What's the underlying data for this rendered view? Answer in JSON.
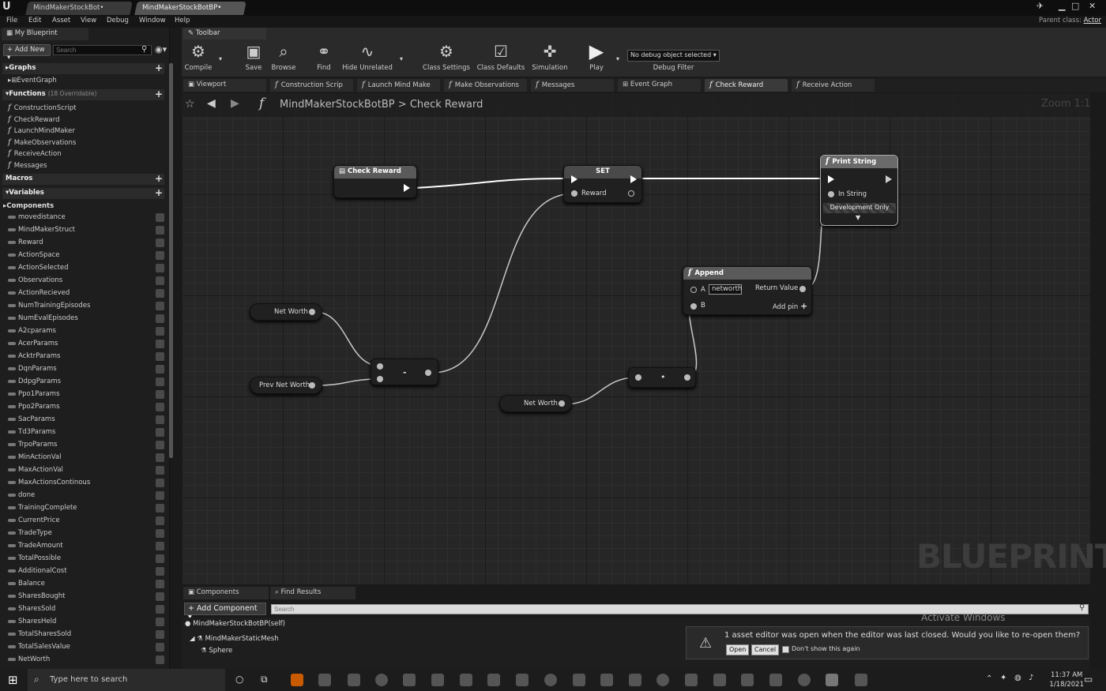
{
  "window": {
    "tabs": [
      "MindMakerStockBot•",
      "MindMakerStockBotBP•"
    ],
    "parent_class_label": "Parent class:",
    "parent_class_value": "Actor"
  },
  "menu": [
    "File",
    "Edit",
    "Asset",
    "View",
    "Debug",
    "Window",
    "Help"
  ],
  "my_blueprint": {
    "tab_label": "My Blueprint",
    "add_new_label": "+ Add New ▾",
    "search_placeholder": "Search",
    "graphs_label": "Graphs",
    "event_graph_label": "EventGraph",
    "functions_label": "Functions",
    "functions_overridable": "(18 Overridable)",
    "functions": [
      "ConstructionScript",
      "CheckReward",
      "LaunchMindMaker",
      "MakeObservations",
      "ReceiveAction",
      "Messages"
    ],
    "macros_label": "Macros",
    "variables_label": "Variables",
    "components_label": "Components",
    "variables": [
      "movedistance",
      "MindMakerStruct",
      "Reward",
      "ActionSpace",
      "ActionSelected",
      "Observations",
      "ActionRecieved",
      "NumTrainingEpisodes",
      "NumEvalEpisodes",
      "A2cparams",
      "AcerParams",
      "AcktrParams",
      "DqnParams",
      "DdpgParams",
      "Ppo1Params",
      "Ppo2Params",
      "SacParams",
      "Td3Params",
      "TrpoParams",
      "MinActionVal",
      "MaxActionVal",
      "MaxActionsContinous",
      "done",
      "TrainingComplete",
      "CurrentPrice",
      "TradeType",
      "TradeAmount",
      "TotalPossible",
      "AdditionalCost",
      "Balance",
      "SharesBought",
      "SharesSold",
      "SharesHeld",
      "TotalSharesSold",
      "TotalSalesValue",
      "NetWorth"
    ]
  },
  "toolbar": {
    "tab_label": "Toolbar",
    "compile": "Compile",
    "save": "Save",
    "browse": "Browse",
    "find": "Find",
    "hide_unrelated": "Hide Unrelated",
    "class_settings": "Class Settings",
    "class_defaults": "Class Defaults",
    "simulation": "Simulation",
    "play": "Play",
    "debug_object": "No debug object selected ▾",
    "debug_filter": "Debug Filter"
  },
  "editor_tabs": [
    "Viewport",
    "Construction Scrip",
    "Launch Mind Make",
    "Make Observations",
    "Messages",
    "Event Graph",
    "Check Reward",
    "Receive Action"
  ],
  "graph": {
    "breadcrumb_root": "MindMakerStockBotBP",
    "breadcrumb_sep": ">",
    "breadcrumb_leaf": "Check Reward",
    "zoom": "Zoom 1:1",
    "watermark": "BLUEPRINT",
    "nodes": {
      "check_reward": "Check Reward",
      "set_title": "SET",
      "set_pin": "Reward",
      "print_title": "Print String",
      "print_pin": "In String",
      "print_dev": "Development Only",
      "append_title": "Append",
      "append_a": "A",
      "append_a_value": "networth",
      "append_b": "B",
      "append_return": "Return Value",
      "append_addpin": "Add pin",
      "net_worth_1": "Net Worth",
      "prev_net_worth": "Prev Net Worth",
      "net_worth_2": "Net Worth",
      "minus_op": "-",
      "dot_op": "•"
    }
  },
  "bottom": {
    "tabs": [
      "Components",
      "Find Results"
    ],
    "add_component": "+ Add Component ▾",
    "search_placeholder": "Search",
    "tree": [
      "MindMakerStockBotBP(self)",
      "MindMakerStaticMesh",
      "Sphere"
    ]
  },
  "notification": {
    "message": "1 asset editor was open when the editor was last closed. Would you like to re-open them?",
    "open": "Open",
    "cancel": "Cancel",
    "dont_show": "Don't show this again"
  },
  "watermark_windows": "Activate Windows",
  "taskbar": {
    "search_placeholder": "Type here to search",
    "time": "11:37 AM",
    "date": "1/18/2021"
  }
}
